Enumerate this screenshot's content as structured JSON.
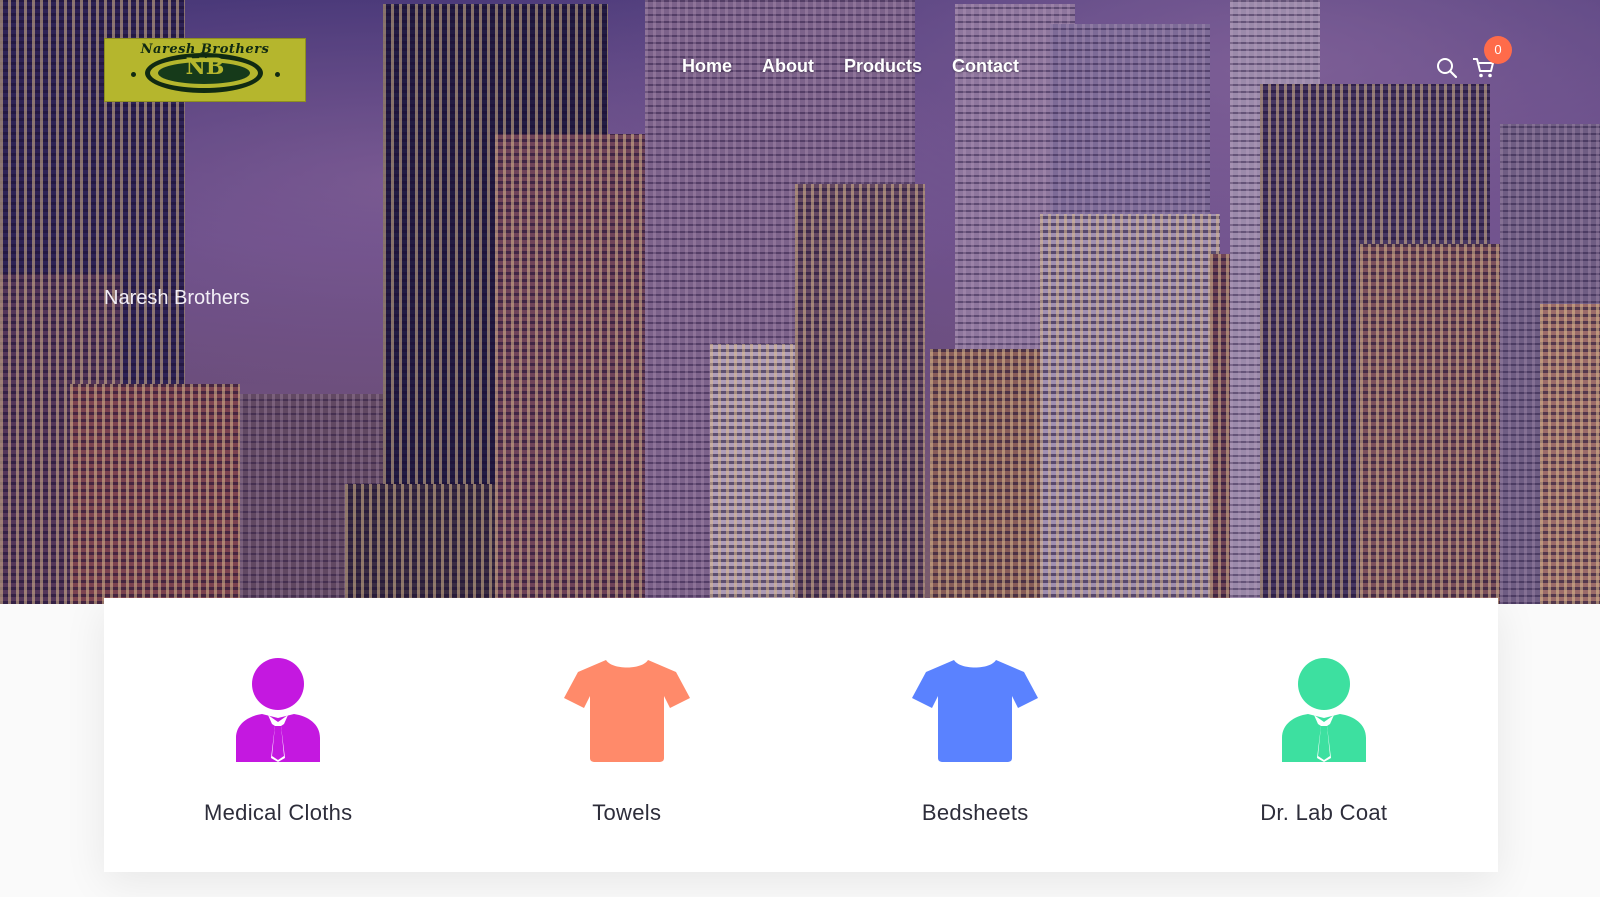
{
  "brand": {
    "logo_text": "Naresh Brothers",
    "logo_monogram": "NB",
    "logo_bg": "#b5b62d"
  },
  "nav": {
    "items": [
      {
        "label": "Home"
      },
      {
        "label": "About"
      },
      {
        "label": "Products"
      },
      {
        "label": "Contact"
      }
    ]
  },
  "header_icons": {
    "search": "search-icon",
    "cart": "cart-icon",
    "cart_count": "0",
    "badge_color": "#ff6b4a"
  },
  "hero": {
    "title": "Naresh Brothers"
  },
  "categories": [
    {
      "label": "Medical Cloths",
      "icon": "person-tie-icon",
      "color": "#c418e0"
    },
    {
      "label": "Towels",
      "icon": "tshirt-icon",
      "color": "#ff8a6a"
    },
    {
      "label": "Bedsheets",
      "icon": "tshirt-icon",
      "color": "#5a82ff"
    },
    {
      "label": "Dr. Lab Coat",
      "icon": "person-tie-icon",
      "color": "#3de0a0"
    }
  ]
}
